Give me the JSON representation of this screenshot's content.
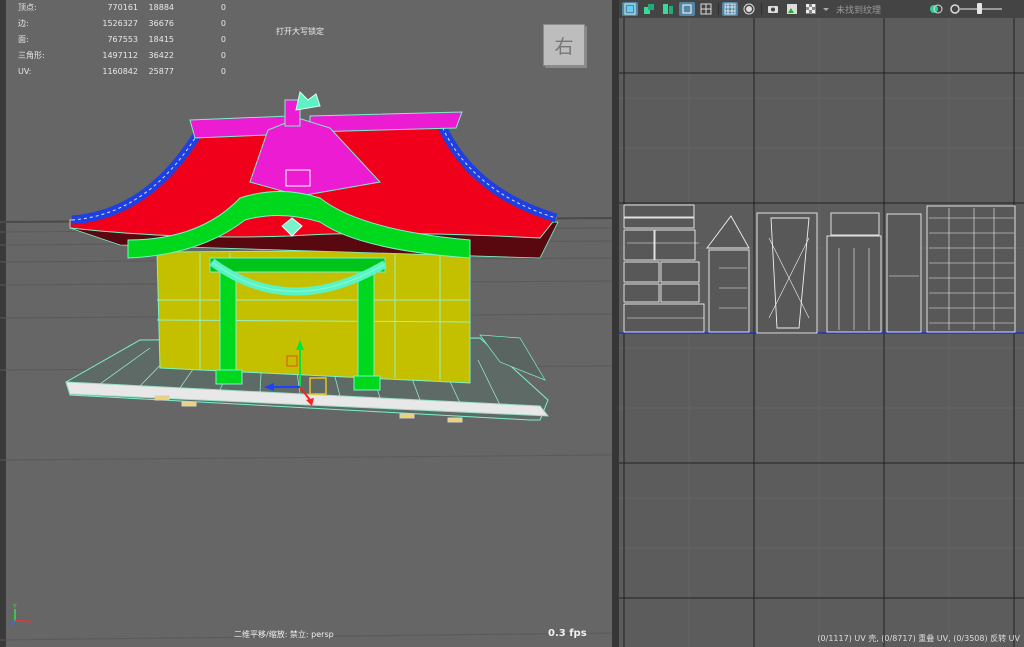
{
  "stats": {
    "rows": [
      {
        "label": "顶点:",
        "v1": "770161",
        "v2": "18884",
        "v3": "0"
      },
      {
        "label": "边:",
        "v1": "1526327",
        "v2": "36676",
        "v3": "0"
      },
      {
        "label": "面:",
        "v1": "767553",
        "v2": "18415",
        "v3": "0"
      },
      {
        "label": "三角形:",
        "v1": "1497112",
        "v2": "36422",
        "v3": "0"
      },
      {
        "label": "UV:",
        "v1": "1160842",
        "v2": "25877",
        "v3": "0"
      }
    ],
    "caps_lock_text": "打开大写锁定"
  },
  "viewport": {
    "viewcube_face": "右",
    "camera_label": "二维平移/缩放: 禁立: persp",
    "fps": "0.3 fps",
    "axis": {
      "y": "Y",
      "x": "X"
    }
  },
  "uv_editor": {
    "texture_placeholder": "未找到纹理",
    "status": "(0/1117) UV 壳, (0/8717) 重叠 UV, (0/3508) 反转 UV",
    "toolbar_icons": [
      "uv-shell-icon",
      "uv-move-icon",
      "uv-flip-icon",
      "uv-isolate-icon",
      "grid-toggle-icon",
      "checker-grid-icon",
      "pixel-snap-icon",
      "snapshot-icon",
      "display-image-icon",
      "checker-map-icon",
      "dropdown-arrow-icon",
      "exposure-icon"
    ]
  },
  "colors": {
    "viewport_bg": "#666666",
    "uv_bg": "#5c5c5c",
    "wire_cyan": "#5cf2c4",
    "roof_red": "#f4001c",
    "roof_magenta": "#ec1cd2",
    "edge_blue": "#1f3fe0",
    "green": "#00dd1a",
    "wall_yellow": "#c8c400"
  }
}
